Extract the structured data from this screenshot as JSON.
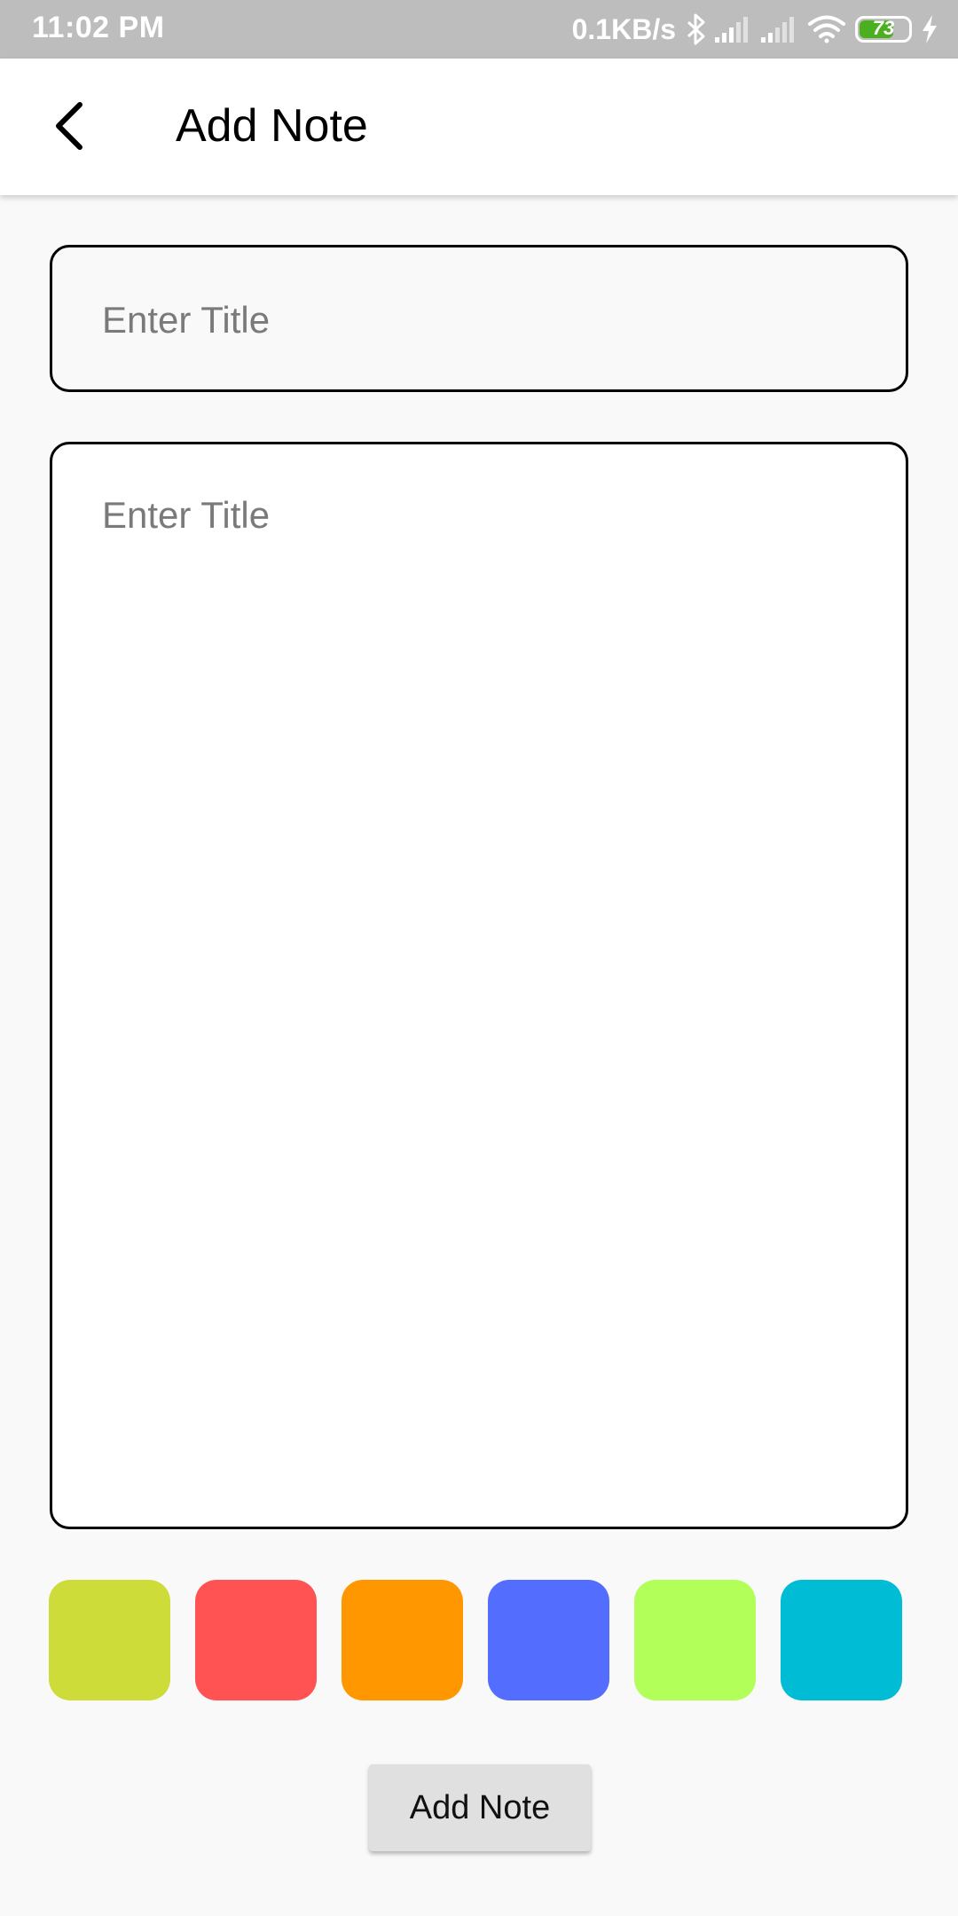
{
  "status_bar": {
    "time": "11:02 PM",
    "network_speed": "0.1KB/s",
    "battery_level": "73",
    "battery_percent": 73,
    "icons": [
      "bluetooth-icon",
      "signal-icon",
      "signal-icon",
      "wifi-icon",
      "battery-icon",
      "charging-icon"
    ]
  },
  "app_bar": {
    "title": "Add Note",
    "back_icon": "chevron-left-icon"
  },
  "form": {
    "title_placeholder": "Enter Title",
    "body_placeholder": "Enter Title"
  },
  "color_palette": [
    {
      "name": "lime",
      "color": "#cddc39"
    },
    {
      "name": "red",
      "color": "#ff5252"
    },
    {
      "name": "orange",
      "color": "#ff9800"
    },
    {
      "name": "indigo",
      "color": "#536dfe"
    },
    {
      "name": "light-green",
      "color": "#b2ff59"
    },
    {
      "name": "cyan",
      "color": "#00bcd4"
    }
  ],
  "actions": {
    "add_label": "Add Note"
  },
  "colors": {
    "status_bar_bg": "#bdbdbd",
    "app_bar_bg": "#ffffff",
    "page_bg": "#f9f9f9",
    "button_bg": "#e0e0e0",
    "battery_fill": "#4caf1f"
  }
}
